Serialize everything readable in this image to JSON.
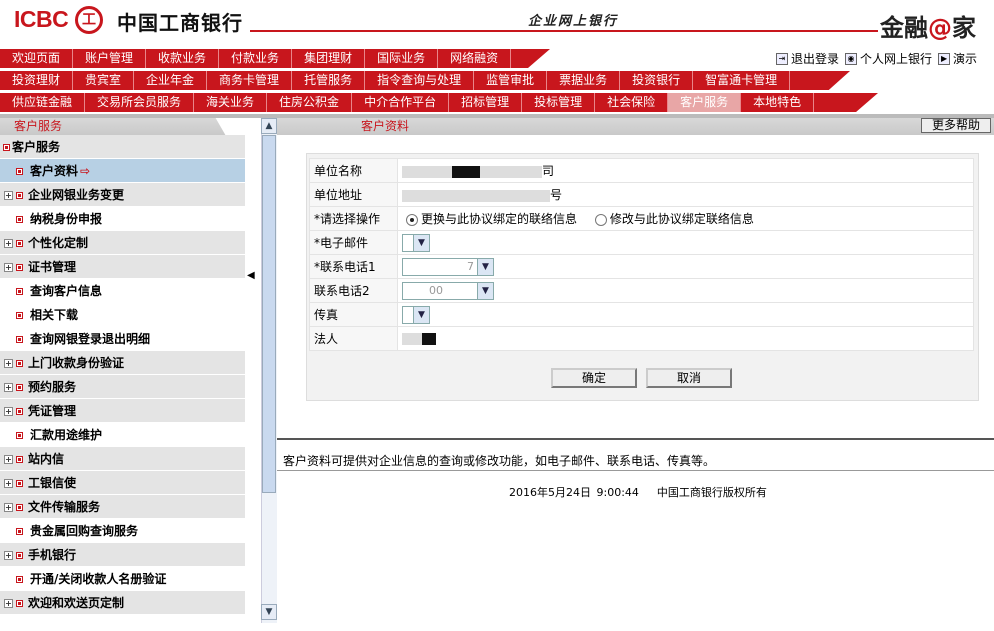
{
  "header": {
    "logo_text": "ICBC",
    "logo_mark": "工",
    "bank_name": "中国工商银行",
    "slogan": "企业网上银行",
    "brand_prefix": "金融",
    "brand_at": "@",
    "brand_suffix": "家"
  },
  "nav": {
    "row1": [
      "欢迎页面",
      "账户管理",
      "收款业务",
      "付款业务",
      "集团理财",
      "国际业务",
      "网络融资"
    ],
    "row2": [
      "投资理财",
      "贵宾室",
      "企业年金",
      "商务卡管理",
      "托管服务",
      "指令查询与处理",
      "监管审批",
      "票据业务",
      "投资银行",
      "智富通卡管理"
    ],
    "row3": [
      "供应链金融",
      "交易所会员服务",
      "海关业务",
      "住房公积金",
      "中介合作平台",
      "招标管理",
      "投标管理",
      "社会保险",
      "客户服务",
      "本地特色"
    ],
    "active": "客户服务"
  },
  "toplinks": {
    "logout": "退出登录",
    "personal": "个人网上银行",
    "demo": "演示"
  },
  "sidebar": {
    "title": "客户服务",
    "items": [
      {
        "label": "客户服务",
        "level": 0,
        "root": true
      },
      {
        "label": "客户资料",
        "level": 1,
        "selected": true
      },
      {
        "label": "企业网银业务变更",
        "level": 0
      },
      {
        "label": "纳税身份申报",
        "level": 1
      },
      {
        "label": "个性化定制",
        "level": 0
      },
      {
        "label": "证书管理",
        "level": 0
      },
      {
        "label": "查询客户信息",
        "level": 1
      },
      {
        "label": "相关下载",
        "level": 1
      },
      {
        "label": "查询网银登录退出明细",
        "level": 1
      },
      {
        "label": "上门收款身份验证",
        "level": 0
      },
      {
        "label": "预约服务",
        "level": 0
      },
      {
        "label": "凭证管理",
        "level": 0
      },
      {
        "label": "汇款用途维护",
        "level": 1
      },
      {
        "label": "站内信",
        "level": 0
      },
      {
        "label": "工银信使",
        "level": 0
      },
      {
        "label": "文件传输服务",
        "level": 0
      },
      {
        "label": "贵金属回购查询服务",
        "level": 1
      },
      {
        "label": "手机银行",
        "level": 0
      },
      {
        "label": "开通/关闭收款人名册验证",
        "level": 1
      },
      {
        "label": "欢迎和欢送页定制",
        "level": 0
      }
    ]
  },
  "main": {
    "tab_title": "客户资料",
    "help_button": "更多帮助",
    "form": {
      "company_name_label": "单位名称",
      "company_name_suffix": "司",
      "company_address_label": "单位地址",
      "company_address_suffix": "号",
      "operation_label": "*请选择操作",
      "option_replace": "更换与此协议绑定的联络信息",
      "option_modify": "修改与此协议绑定联络信息",
      "email_label": "*电子邮件",
      "phone1_label": "*联系电话1",
      "phone1_value": "7",
      "phone2_label": "联系电话2",
      "phone2_value": "00",
      "fax_label": "传真",
      "legal_label": "法人"
    },
    "confirm_button": "确定",
    "cancel_button": "取消",
    "description": "客户资料可提供对企业信息的查询或修改功能，如电子邮件、联系电话、传真等。",
    "footer_date": "2016年5月24日  9:00:44",
    "footer_copyright": "中国工商银行版权所有"
  }
}
